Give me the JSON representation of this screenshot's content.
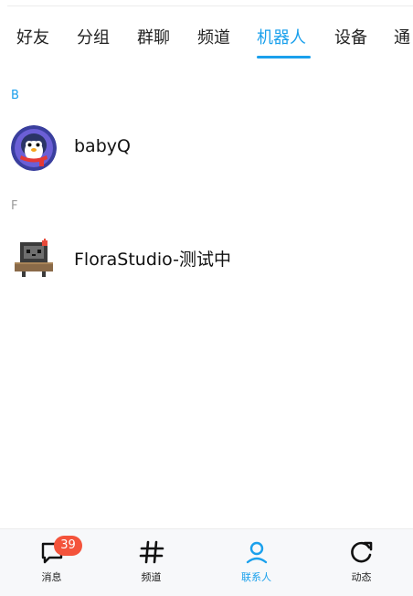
{
  "tabs": [
    {
      "label": "好友"
    },
    {
      "label": "分组"
    },
    {
      "label": "群聊"
    },
    {
      "label": "频道"
    },
    {
      "label": "机器人",
      "active": true
    },
    {
      "label": "设备"
    },
    {
      "label": "通"
    }
  ],
  "sections": [
    {
      "letter": "B",
      "contacts": [
        {
          "name": "babyQ"
        }
      ]
    },
    {
      "letter": "F",
      "contacts": [
        {
          "name": "FloraStudio-测试中"
        }
      ]
    }
  ],
  "bottom_nav": [
    {
      "label": "消息",
      "icon": "chat-bubble-icon",
      "badge": "39"
    },
    {
      "label": "频道",
      "icon": "hash-icon"
    },
    {
      "label": "联系人",
      "icon": "person-icon",
      "active": true
    },
    {
      "label": "动态",
      "icon": "refresh-icon"
    }
  ],
  "colors": {
    "accent": "#1aa0ec",
    "badge": "#f4533b"
  }
}
